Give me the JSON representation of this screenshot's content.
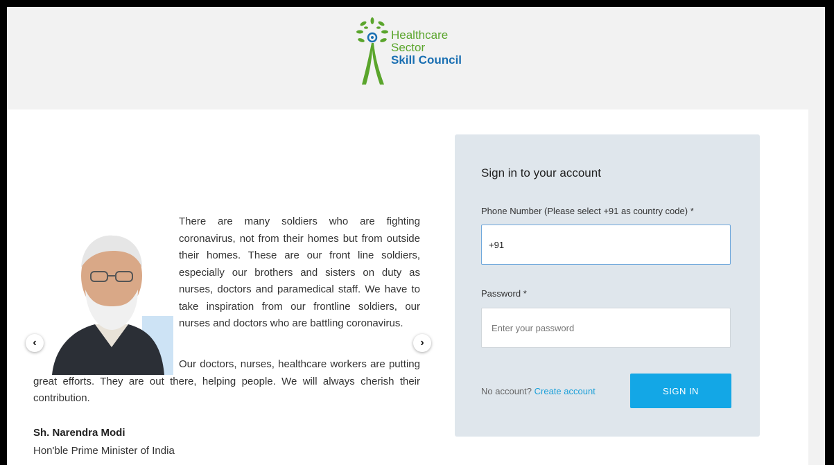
{
  "brand": {
    "line1": "Healthcare",
    "line2": "Sector",
    "line3": "Skill Council"
  },
  "carousel": {
    "quote_part1": "There are many soldiers who are fighting coronavirus, not from their homes but from outside their homes. These are our front line soldiers, especially our brothers and sisters on duty as nurses, doctors and paramedical staff. We have to take inspiration from our frontline soldiers, our nurses and doctors who are battling coronavirus.",
    "quote_part2": "Our doctors, nurses, healthcare workers are putting great efforts. They are out there, helping people. We will always cherish their contribution.",
    "author_name": "Sh. Narendra Modi",
    "author_title": "Hon'ble Prime Minister of India",
    "prev_icon": "chevron-left-icon",
    "next_icon": "chevron-right-icon"
  },
  "login": {
    "title": "Sign in to your account",
    "phone_label": "Phone Number (Please select +91 as country code) *",
    "phone_value": "+91",
    "password_label": "Password *",
    "password_placeholder": "Enter your password",
    "no_account_text": "No account?",
    "create_account_link": "Create account",
    "signin_button": "SIGN IN"
  },
  "colors": {
    "brand_green": "#5aa52c",
    "brand_blue": "#1a6fb2",
    "accent": "#13a7e6",
    "card_bg": "#dfe6ec"
  }
}
